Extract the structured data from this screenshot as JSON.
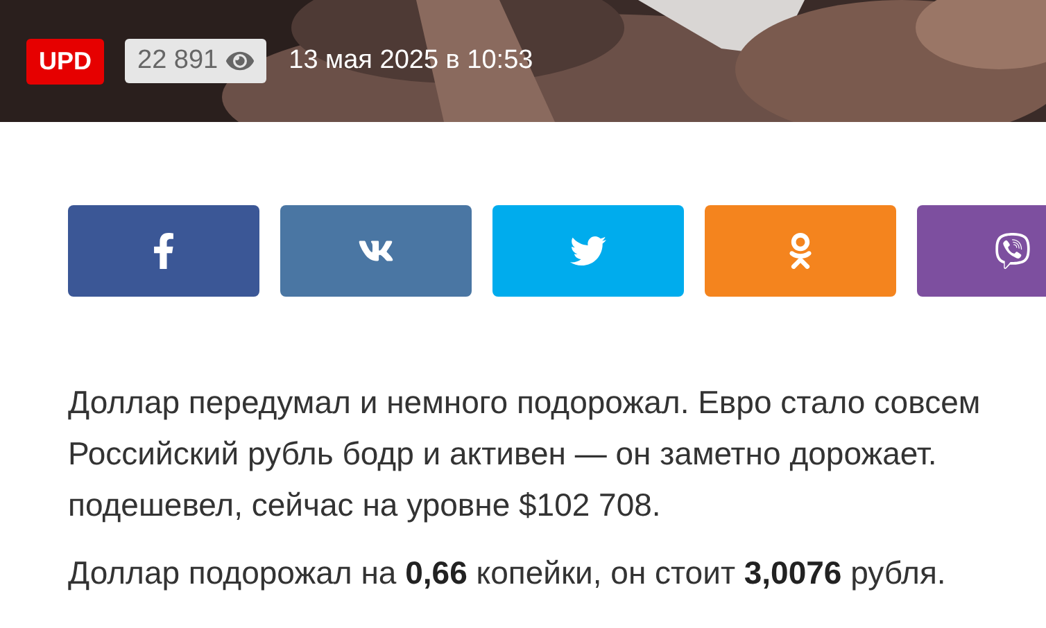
{
  "header": {
    "badge": "UPD",
    "views": "22 891",
    "date": "13 мая 2025 в 10:53"
  },
  "share_buttons": [
    {
      "kind": "facebook",
      "color": "#3b5796"
    },
    {
      "kind": "vk",
      "color": "#4a76a3"
    },
    {
      "kind": "twitter",
      "color": "#00aced"
    },
    {
      "kind": "odnoklassniki",
      "color": "#f4841e"
    },
    {
      "kind": "viber",
      "color": "#7d4f9f"
    }
  ],
  "paragraphs": [
    [
      "Доллар передумал и немного подорожал. Евро стало совсем",
      "Российский рубль бодр и активен — он заметно дорожает.",
      "подешевел, сейчас на уровне $102 708."
    ],
    [
      "Доллар подорожал на **0,66** копейки, он стоит **3,0076** рубля."
    ]
  ]
}
